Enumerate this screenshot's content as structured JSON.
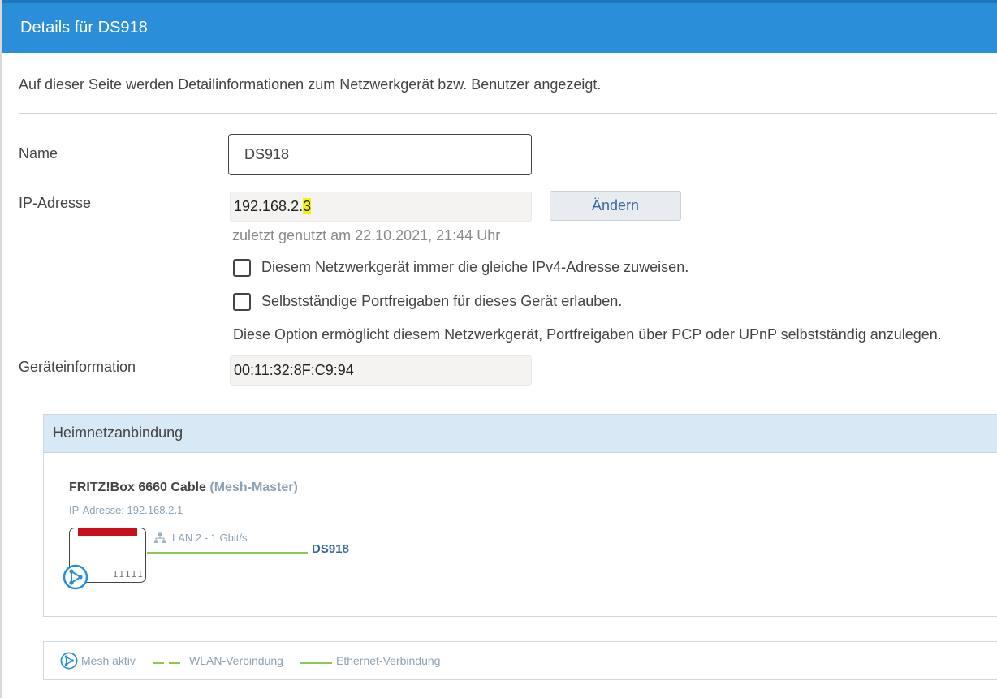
{
  "header": {
    "title": "Details für DS918"
  },
  "intro": "Auf dieser Seite werden Detailinformationen zum Netzwerkgerät bzw. Benutzer angezeigt.",
  "form": {
    "name_label": "Name",
    "name_value": "DS918",
    "ip_label": "IP-Adresse",
    "ip_value_prefix": "192.168.2.",
    "ip_value_highlight": "3",
    "change_button": "Ändern",
    "last_used": "zuletzt genutzt am 22.10.2021, 21:44 Uhr",
    "checkbox_ipv4": {
      "label": "Diesem Netzwerkgerät immer die gleiche IPv4-Adresse zuweisen.",
      "checked": false
    },
    "checkbox_port": {
      "label": "Selbstständige Portfreigaben für dieses Gerät erlauben.",
      "checked": false
    },
    "port_note": "Diese Option ermöglicht diesem Netzwerkgerät, Portfreigaben über PCP oder UPnP selbstständig anzulegen.",
    "device_info_label": "Geräteinformation",
    "device_info_value": "00:11:32:8F:C9:94"
  },
  "home_network": {
    "title": "Heimnetzanbindung",
    "router_name": "FRITZ!Box 6660 Cable",
    "router_role": "(Mesh-Master)",
    "router_ip": "IP-Adresse: 192.168.2.1",
    "link_label": "LAN 2 - 1 Gbit/s",
    "client_name": "DS918",
    "router_vents": "IIIII"
  },
  "legend": {
    "mesh": "Mesh aktiv",
    "wlan": "WLAN-Verbindung",
    "ethernet": "Ethernet-Verbindung"
  },
  "colors": {
    "header": "#2a8fd8",
    "panel_head": "#d8e8f4",
    "link_green": "#8cc94e",
    "highlight": "#f5f500",
    "brand_red": "#c8101a",
    "mesh_blue": "#2a8fd8"
  },
  "icons": {
    "mesh": "mesh-icon",
    "network": "network-icon",
    "router": "router-icon"
  }
}
